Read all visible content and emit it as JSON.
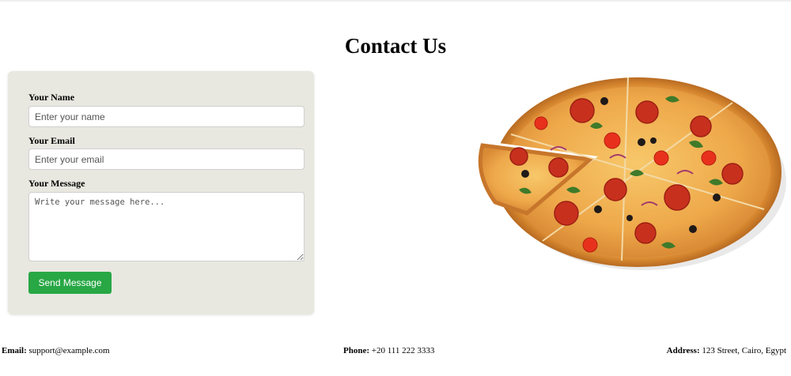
{
  "page": {
    "title": "Contact Us"
  },
  "form": {
    "name_label": "Your Name",
    "name_placeholder": "Enter your name",
    "email_label": "Your Email",
    "email_placeholder": "Enter your email",
    "message_label": "Your Message",
    "message_placeholder": "Write your message here...",
    "submit_label": "Send Message",
    "submit_color": "#28a745",
    "card_color": "#e8e8e1"
  },
  "image": {
    "subject": "pizza"
  },
  "footer": {
    "email_label": "Email:",
    "email_value": "support@example.com",
    "phone_label": "Phone:",
    "phone_value": "+20 111 222 3333",
    "address_label": "Address:",
    "address_value": "123 Street, Cairo, Egypt"
  }
}
